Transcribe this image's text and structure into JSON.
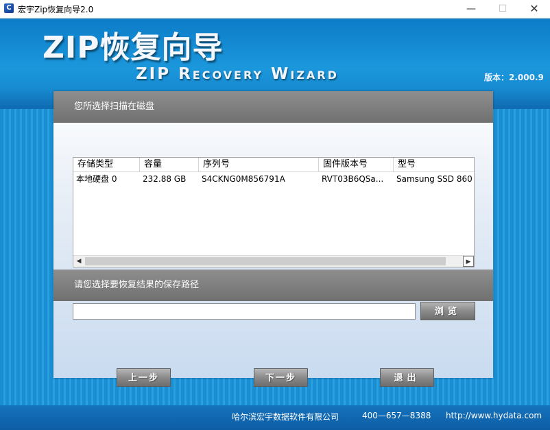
{
  "window": {
    "title": "宏宇Zip恢复向导2.0",
    "minimize_glyph": "—",
    "maximize_glyph": "☐",
    "close_glyph": "✕"
  },
  "banner": {
    "logo_cn": "ZIP恢复向导",
    "logo_en": "ZIP Recovery Wizard",
    "version": "版本：2.000.9"
  },
  "disk_section": {
    "title": "您所选择扫描在磁盘",
    "columns": [
      "存储类型",
      "容量",
      "序列号",
      "固件版本号",
      "型号"
    ],
    "rows": [
      [
        "本地硬盘 0",
        "232.88 GB",
        "S4CKNG0M856791A",
        "RVT03B6QSa...",
        "Samsung SSD 860"
      ]
    ]
  },
  "path_section": {
    "title": "请您选择要恢复结果的保存路径",
    "path_value": "",
    "browse_label": "浏览"
  },
  "nav": {
    "prev_label": "上一步",
    "next_label": "下一步",
    "exit_label": "退出"
  },
  "footer": {
    "company": "哈尔滨宏宇数据软件有限公司",
    "phone": "400—657—8388",
    "website": "http://www.hydata.com"
  },
  "colors": {
    "banner_blue": "#1b97dc",
    "section_gray": "#7a7a7a",
    "footer_blue": "#0d5da5"
  }
}
